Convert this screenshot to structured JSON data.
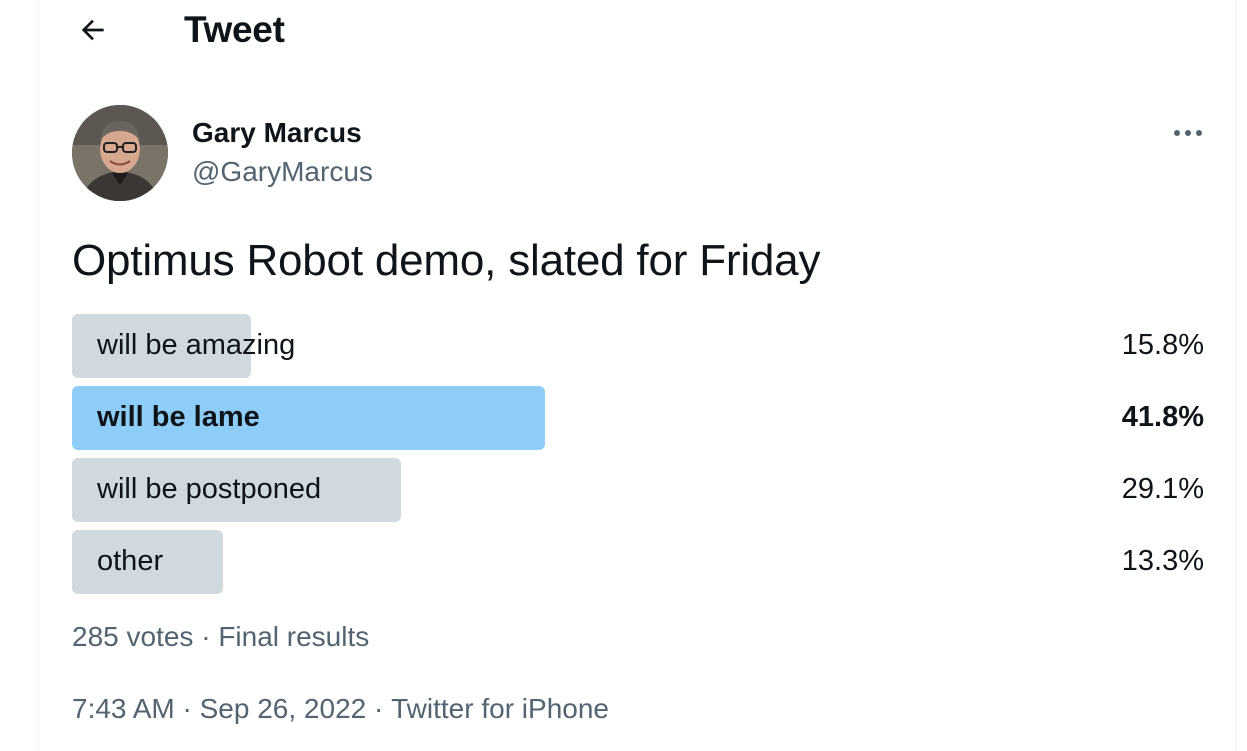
{
  "header": {
    "title": "Tweet",
    "back_icon": "arrow-left-icon"
  },
  "author": {
    "display_name": "Gary Marcus",
    "handle": "@GaryMarcus",
    "more_icon": "more-horizontal-icon"
  },
  "tweet": {
    "text": "Optimus Robot demo, slated for Friday"
  },
  "poll": {
    "options": [
      {
        "label": "will be amazing",
        "percent_text": "15.8%",
        "percent": 15.8,
        "winner": false
      },
      {
        "label": "will be lame",
        "percent_text": "41.8%",
        "percent": 41.8,
        "winner": true
      },
      {
        "label": "will be postponed",
        "percent_text": "29.1%",
        "percent": 29.1,
        "winner": false
      },
      {
        "label": "other",
        "percent_text": "13.3%",
        "percent": 13.3,
        "winner": false
      }
    ],
    "votes": "285 votes",
    "separator": " · ",
    "status": "Final results"
  },
  "meta": {
    "time": "7:43 AM",
    "date": "Sep 26, 2022",
    "source": "Twitter for iPhone",
    "separator": " · "
  },
  "colors": {
    "bar": "#cfd9de",
    "bar_winner": "#8ecdf8",
    "secondary_text": "#536471"
  }
}
